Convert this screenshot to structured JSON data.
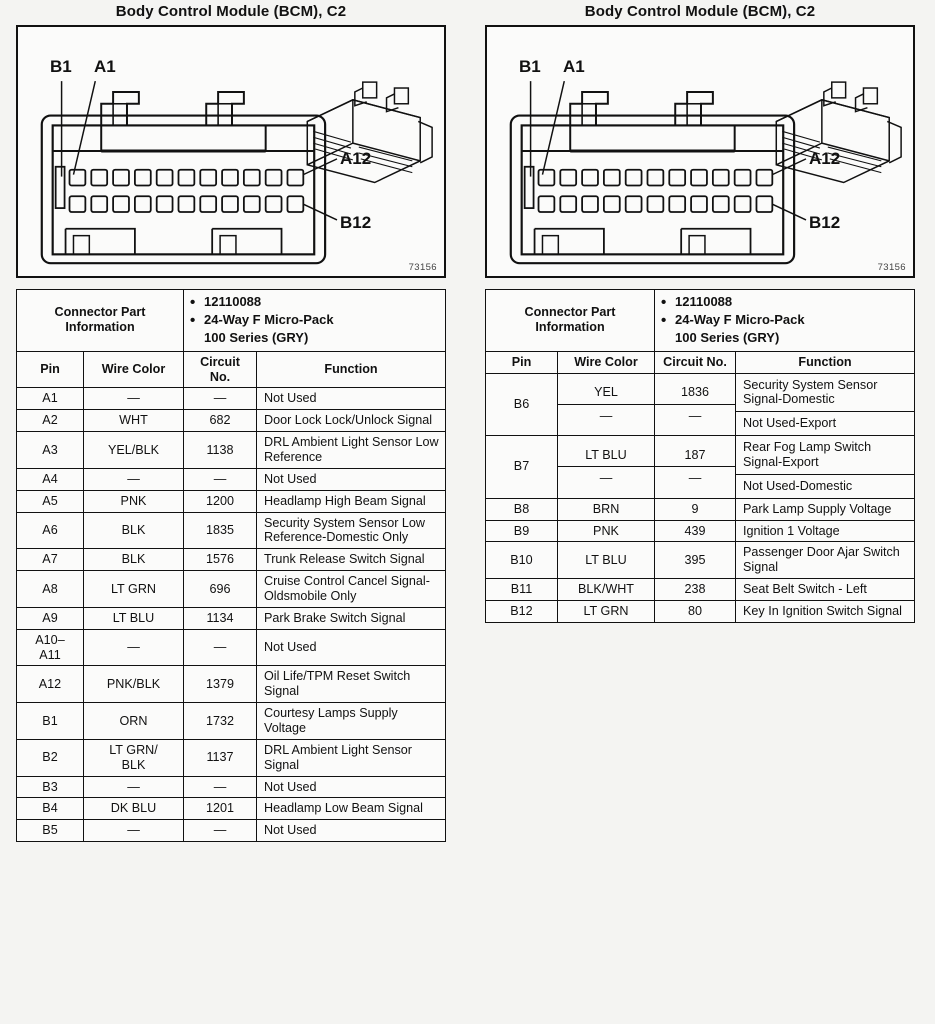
{
  "figure_id": "73156",
  "panels": [
    {
      "title": "Body Control Module (BCM), C2",
      "diagram": {
        "callouts": {
          "b1": "B1",
          "a1": "A1",
          "a12": "A12",
          "b12": "B12"
        },
        "figure_id": "73156",
        "rows": 2,
        "cavities_per_row": 12
      },
      "connector_part_information": {
        "label": "Connector Part Information",
        "bullets": [
          "12110088",
          "24-Way F Micro-Pack",
          "100 Series (GRY)"
        ]
      },
      "columns": {
        "pin": "Pin",
        "wire_color": "Wire Color",
        "circuit_no": "Circuit No.",
        "function": "Function"
      },
      "rows": [
        {
          "pin": "A1",
          "wire_color": "—",
          "circuit_no": "—",
          "function": "Not Used"
        },
        {
          "pin": "A2",
          "wire_color": "WHT",
          "circuit_no": "682",
          "function": "Door Lock Lock/Unlock Signal"
        },
        {
          "pin": "A3",
          "wire_color": "YEL/BLK",
          "circuit_no": "1138",
          "function": "DRL Ambient Light Sensor Low Reference"
        },
        {
          "pin": "A4",
          "wire_color": "—",
          "circuit_no": "—",
          "function": "Not Used"
        },
        {
          "pin": "A5",
          "wire_color": "PNK",
          "circuit_no": "1200",
          "function": "Headlamp High Beam Signal"
        },
        {
          "pin": "A6",
          "wire_color": "BLK",
          "circuit_no": "1835",
          "function": "Security System Sensor Low Reference-Domestic Only"
        },
        {
          "pin": "A7",
          "wire_color": "BLK",
          "circuit_no": "1576",
          "function": "Trunk Release Switch Signal"
        },
        {
          "pin": "A8",
          "wire_color": "LT GRN",
          "circuit_no": "696",
          "function": "Cruise Control Cancel Signal-Oldsmobile Only"
        },
        {
          "pin": "A9",
          "wire_color": "LT BLU",
          "circuit_no": "1134",
          "function": "Park Brake Switch Signal"
        },
        {
          "pin": "A10–\nA11",
          "wire_color": "—",
          "circuit_no": "—",
          "function": "Not Used"
        },
        {
          "pin": "A12",
          "wire_color": "PNK/BLK",
          "circuit_no": "1379",
          "function": "Oil Life/TPM Reset Switch Signal"
        },
        {
          "pin": "B1",
          "wire_color": "ORN",
          "circuit_no": "1732",
          "function": "Courtesy Lamps Supply Voltage"
        },
        {
          "pin": "B2",
          "wire_color": "LT GRN/\nBLK",
          "circuit_no": "1137",
          "function": "DRL Ambient Light Sensor Signal"
        },
        {
          "pin": "B3",
          "wire_color": "—",
          "circuit_no": "—",
          "function": "Not Used"
        },
        {
          "pin": "B4",
          "wire_color": "DK BLU",
          "circuit_no": "1201",
          "function": "Headlamp Low Beam Signal"
        },
        {
          "pin": "B5",
          "wire_color": "—",
          "circuit_no": "—",
          "function": "Not Used"
        }
      ]
    },
    {
      "title": "Body Control Module (BCM), C2",
      "diagram": {
        "callouts": {
          "b1": "B1",
          "a1": "A1",
          "a12": "A12",
          "b12": "B12"
        },
        "figure_id": "73156",
        "rows": 2,
        "cavities_per_row": 12
      },
      "connector_part_information": {
        "label": "Connector Part Information",
        "bullets": [
          "12110088",
          "24-Way F Micro-Pack",
          "100 Series (GRY)"
        ]
      },
      "columns": {
        "pin": "Pin",
        "wire_color": "Wire Color",
        "circuit_no": "Circuit No.",
        "function": "Function"
      },
      "rows": [
        {
          "pin": "B6",
          "split": [
            {
              "wire_color": "YEL",
              "circuit_no": "1836",
              "function": "Security System Sensor Signal-Domestic"
            },
            {
              "wire_color": "—",
              "circuit_no": "—",
              "function": "Not Used-Export"
            }
          ]
        },
        {
          "pin": "B7",
          "split": [
            {
              "wire_color": "LT BLU",
              "circuit_no": "187",
              "function": "Rear Fog Lamp Switch Signal-Export"
            },
            {
              "wire_color": "—",
              "circuit_no": "—",
              "function": "Not Used-Domestic"
            }
          ]
        },
        {
          "pin": "B8",
          "wire_color": "BRN",
          "circuit_no": "9",
          "function": "Park Lamp Supply Voltage"
        },
        {
          "pin": "B9",
          "wire_color": "PNK",
          "circuit_no": "439",
          "function": "Ignition 1 Voltage"
        },
        {
          "pin": "B10",
          "wire_color": "LT BLU",
          "circuit_no": "395",
          "function": "Passenger Door Ajar Switch Signal"
        },
        {
          "pin": "B11",
          "wire_color": "BLK/WHT",
          "circuit_no": "238",
          "function": "Seat Belt Switch - Left"
        },
        {
          "pin": "B12",
          "wire_color": "LT GRN",
          "circuit_no": "80",
          "function": "Key In Ignition Switch Signal"
        }
      ]
    }
  ]
}
